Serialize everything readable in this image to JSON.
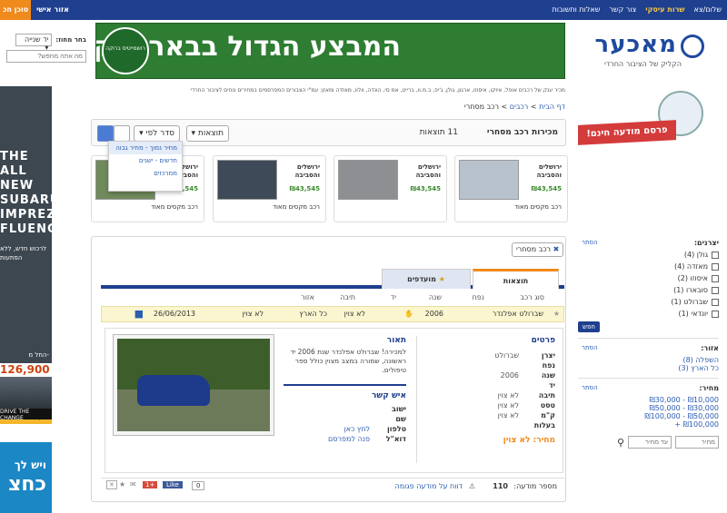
{
  "topbar": {
    "links": [
      "שלום/צא",
      "שרות עיסקי",
      "צור קשר",
      "שאלות ותשובות"
    ],
    "personal_area": "אזור אישי",
    "agent_button": "סוכן חכ"
  },
  "left_search": {
    "label": "בחר מחוז:",
    "select_value": "יד שנייה",
    "search_placeholder": "מה אתה מחפש?"
  },
  "left_ad": {
    "headline": "THE ALL NEW SUBARU IMPREZA... FLUENCE",
    "sub": "לרכוש חדש, ללא הפתעות",
    "price_prefix": "החל מ-",
    "price": "126,900",
    "cta": "לחץ לפרטים",
    "slogan": "DRIVE THE CHANGE"
  },
  "left_ad2": {
    "line1": "ויש לך",
    "line2": "כחצ"
  },
  "logo": {
    "name": "מאכער",
    "tagline": "הקליק של הציבור החרדי"
  },
  "banner": {
    "text": "המבצע הגדול בבאר יעקב!",
    "seal": "רושמייטיס ברוקה"
  },
  "tagline_text": "מכיר ענק של רכבים אופל, איוקו, איסוזו, ארגון, גולן, ג'יפ, ב.מ.וו, ברייט, אמ סי, הונדה, וולוו, מאזדה ומאזן: עמ\"י הצבורים המפרסמים במחירים נוחים לציבור החרדי",
  "breadcrumb": {
    "home": "דף הבית",
    "sep": ">",
    "cars": "רכבים",
    "current": "רכב מסחרי"
  },
  "ad_promo": "פרסם מודעה חינם!",
  "toolbar": {
    "title": "מכירות רכב מסחרי",
    "count": "11 תוצאות",
    "sort_label": "סדר לפי",
    "results_label": "תוצאות"
  },
  "sort_dropdown": [
    "מחיר נמוך - מחיר גבוה",
    "חדשים - ישנים",
    "ממרכזים"
  ],
  "cards": [
    {
      "location": "ירושלים והסביבה",
      "price": "₪43,545",
      "desc": "רכב מקסים מאוד"
    },
    {
      "location": "ירושלים והסביבה",
      "price": "₪43,545",
      "desc": ""
    },
    {
      "location": "ירושלים והסביבה",
      "price": "₪43,545",
      "desc": "רכב מקסים מאוד"
    },
    {
      "location": "ירושלים והסביבה",
      "price": "₪43,545",
      "desc": "רכב מקסים מאוד"
    }
  ],
  "detail": {
    "category_button": "רכב מסחרי",
    "tab_results": "תוצאות",
    "tab_favorites": "מועדפים",
    "headers": [
      "סוג רכב",
      "נפח",
      "שנה",
      "יד",
      "תיבה",
      "אזור"
    ],
    "row": {
      "type": "שברולט אפלנדר",
      "year": "2006",
      "hand": "לא צוין",
      "region": "כל הארץ",
      "gearbox": "לא צוין",
      "date": "26/06/2013"
    },
    "details_title": "פרטים",
    "details": [
      {
        "k": "יצרן",
        "v": "שברולט"
      },
      {
        "k": "נפח",
        "v": ""
      },
      {
        "k": "שנה",
        "v": "2006"
      },
      {
        "k": "יד",
        "v": ""
      },
      {
        "k": "תיבה",
        "v": "לא צוין"
      },
      {
        "k": "טסט",
        "v": "לא צוין"
      },
      {
        "k": "ק\"מ",
        "v": "לא צוין"
      },
      {
        "k": "בעלות",
        "v": ""
      }
    ],
    "price_label": "מחיר: לא צוין",
    "desc_title": "תאור",
    "desc_text": "למכירה! שברולט אפלנדר שנת 2006 יד ראשונה, שמורה במצב מצוין כולל ספר טיפולים.",
    "contact_title": "איש קשר",
    "contact": [
      {
        "k": "ישוב",
        "v": ""
      },
      {
        "k": "שם",
        "v": ""
      },
      {
        "k": "טלפון",
        "v": "לחץ כאן"
      },
      {
        "k": "דוא\"ל",
        "v": "פנה למפרסם"
      }
    ],
    "ad_number_label": "מספר מודעה:",
    "ad_number": "110",
    "report": "דווח על מודעה פגומה",
    "like": "Like",
    "like_count": "0",
    "gplus": "+1"
  },
  "filters": {
    "makers_title": "יצרנים:",
    "clear": "הסתר",
    "makers": [
      "גולן (4)",
      "מאזדה (4)",
      "איסוזו (2)",
      "סובארו (1)",
      "שברולט (1)",
      "יונדאי (1)"
    ],
    "search_btn": "חפש",
    "region_title": "אזור:",
    "regions": [
      "השפלה (8)",
      "כל הארץ (3)"
    ],
    "price_title": "מחיר:",
    "prices": [
      "₪10,000 - ₪30,000",
      "₪30,000 - ₪50,000",
      "₪50,000 - ₪100,000",
      "₪100,000 +"
    ],
    "from_placeholder": "מחיר",
    "to_placeholder": "עד מחיר"
  },
  "colors": {
    "primary": "#1f3f8f",
    "accent": "#f08a1c",
    "promo_red": "#d43b3b",
    "banner_green": "#2e7d32"
  }
}
